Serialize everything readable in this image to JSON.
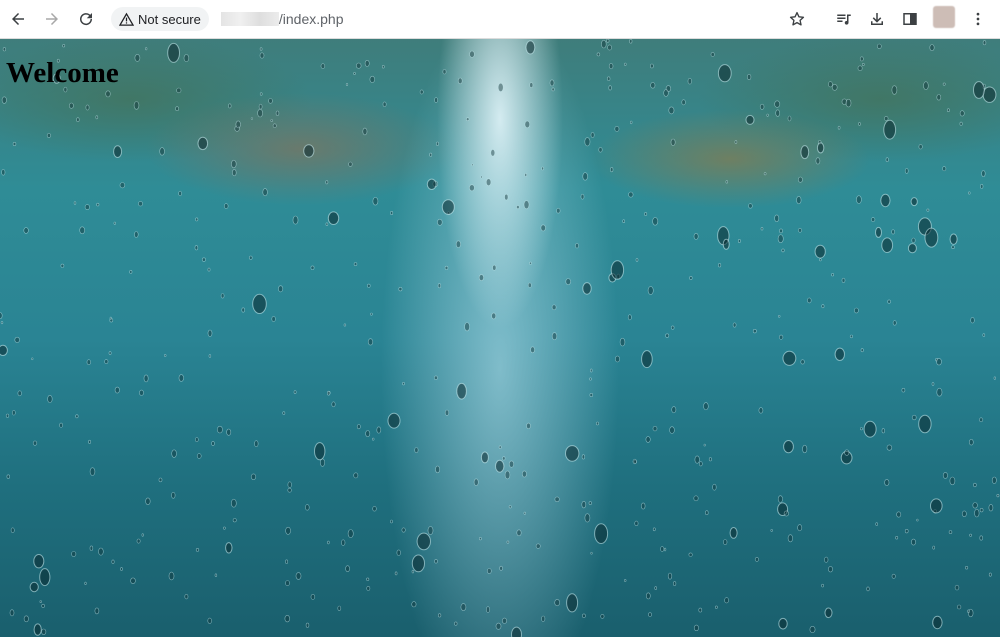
{
  "browser": {
    "security_label": "Not secure",
    "url_path": "/index.php",
    "icons": [
      "back-arrow-icon",
      "forward-arrow-icon",
      "reload-icon",
      "warning-triangle-icon",
      "star-icon",
      "media-queue-icon",
      "download-icon",
      "side-panel-icon",
      "profile-avatar",
      "more-vert-icon"
    ]
  },
  "page": {
    "heading": "Welcome",
    "background": "blurred rain drops on glass over teal street scene"
  },
  "colors": {
    "toolbar_bg": "#ffffff",
    "heading_text": "#000000",
    "background_teal": "#2a8494"
  }
}
